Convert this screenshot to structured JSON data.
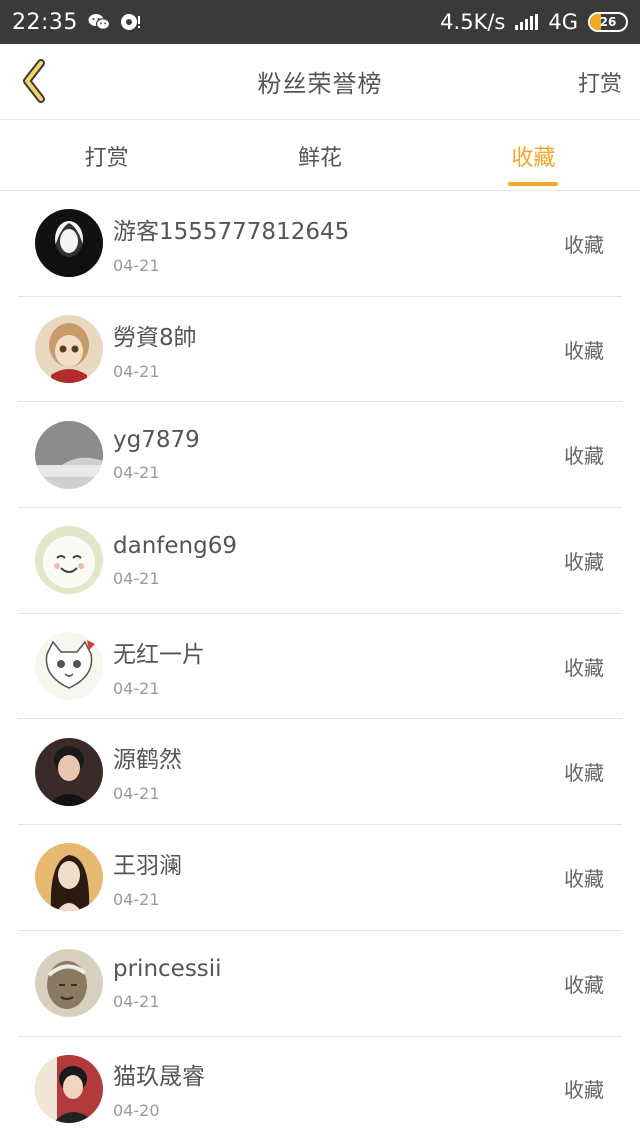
{
  "status_bar": {
    "time": "22:35",
    "net_speed": "4.5K/s",
    "network": "4G",
    "battery": "26"
  },
  "header": {
    "title": "粉丝荣誉榜",
    "right_link": "打赏"
  },
  "tabs": [
    {
      "label": "打赏",
      "active": false
    },
    {
      "label": "鲜花",
      "active": false
    },
    {
      "label": "收藏",
      "active": true
    }
  ],
  "list": [
    {
      "name": "游客1555777812645",
      "date": "04-21",
      "action": "收藏",
      "avatar_color": "#1b1b1b"
    },
    {
      "name": "勞資8帥",
      "date": "04-21",
      "action": "收藏",
      "avatar_color": "#c9a27b"
    },
    {
      "name": "yg7879",
      "date": "04-21",
      "action": "收藏",
      "avatar_color": "#9a9a9a"
    },
    {
      "name": "danfeng69",
      "date": "04-21",
      "action": "收藏",
      "avatar_color": "#e9e7d8"
    },
    {
      "name": "无红一片",
      "date": "04-21",
      "action": "收藏",
      "avatar_color": "#f2efe6"
    },
    {
      "name": "源鹤然",
      "date": "04-21",
      "action": "收藏",
      "avatar_color": "#2c2c2c"
    },
    {
      "name": "王羽澜",
      "date": "04-21",
      "action": "收藏",
      "avatar_color": "#d9a55a"
    },
    {
      "name": "princessii",
      "date": "04-21",
      "action": "收藏",
      "avatar_color": "#8a7c68"
    },
    {
      "name": "猫玖晟睿",
      "date": "04-20",
      "action": "收藏",
      "avatar_color": "#a33a3a"
    }
  ],
  "colors": {
    "accent": "#f5a623",
    "status_bar": "#3a3a3a",
    "text": "#555555",
    "muted": "#9a9a9a",
    "divider": "#e6e6e6"
  }
}
